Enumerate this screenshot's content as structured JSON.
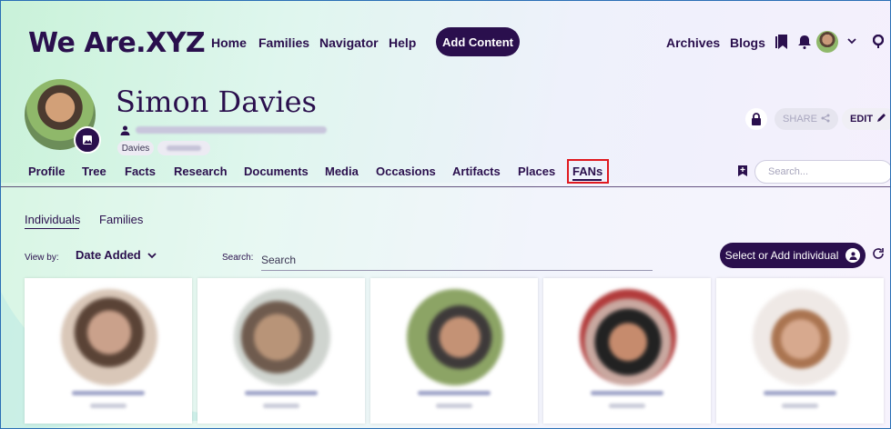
{
  "header": {
    "logo_text": "We Are.",
    "logo_suffix": "XYZ",
    "nav": [
      "Home",
      "Families",
      "Navigator",
      "Help"
    ],
    "add_content": "Add Content",
    "right_nav": [
      "Archives",
      "Blogs"
    ]
  },
  "profile": {
    "name": "Simon Davies",
    "tag": "Davies"
  },
  "actions": {
    "share": "SHARE",
    "edit": "EDIT"
  },
  "tabs": [
    "Profile",
    "Tree",
    "Facts",
    "Research",
    "Documents",
    "Media",
    "Occasions",
    "Artifacts",
    "Places",
    "FANs"
  ],
  "active_tab": "FANs",
  "top_search": {
    "placeholder": "Search..."
  },
  "subtabs": [
    "Individuals",
    "Families"
  ],
  "active_subtab": "Individuals",
  "view_by": {
    "label": "View by:",
    "value": "Date Added"
  },
  "search": {
    "label": "Search:",
    "placeholder": "Search"
  },
  "add_individual": "Select or Add individual",
  "colors": {
    "brand": "#2a0f4d",
    "highlight": "#e0191f"
  },
  "cards": [
    {
      "face": "radial-gradient(circle at 50% 45%, #caa18b 0 30%, #5a4336 31% 48%, #d9c7b8 49%)"
    },
    {
      "face": "radial-gradient(circle at 45% 50%, #b89478 0 32%, #6f5b4e 33% 50%, #cfd4cf 51%)"
    },
    {
      "face": "radial-gradient(circle at 55% 50%, #c49275 0 28%, #3e3a3a 29% 44%, #8ca465 45%)"
    },
    {
      "face": "radial-gradient(circle at 50% 55%, #c68b6d 0 26%, #222 27% 46%, #c9a8a0 47% 60%, #b23b3b 61%)"
    },
    {
      "face": "radial-gradient(circle at 50% 52%, #d7a98e 0 28%, #aa7450 29% 42%, #efe9e6 43%)"
    }
  ]
}
